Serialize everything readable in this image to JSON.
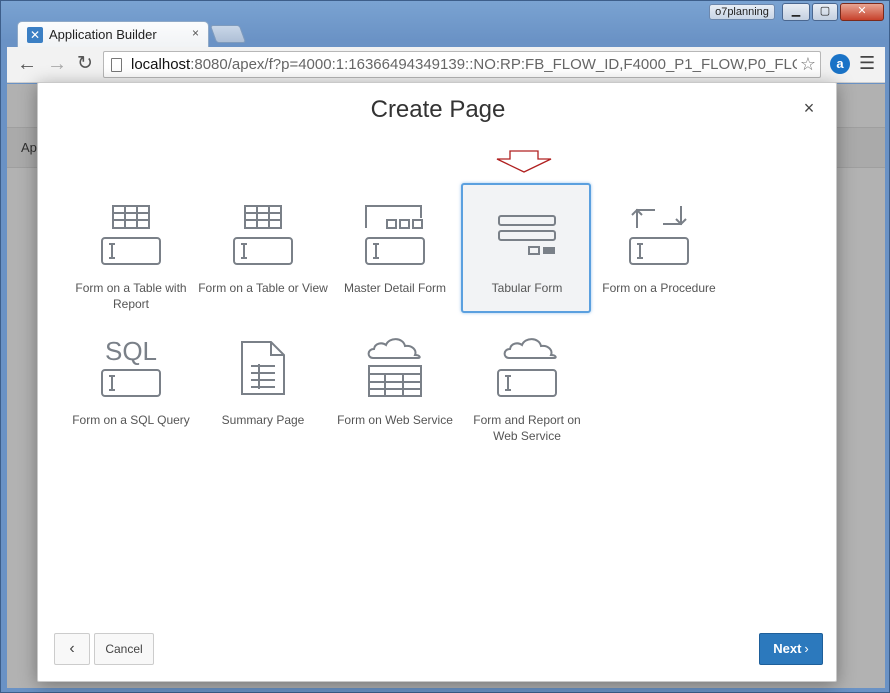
{
  "browser": {
    "tab_title": "Application Builder",
    "tab_close": "×",
    "user_badge": "o7planning",
    "window_controls": {
      "minimize": "▁",
      "maximize": "▢",
      "close": "✕"
    },
    "url_host": "localhost",
    "url_rest": ":8080/apex/f?p=4000:1:16366494349139::NO:RP:FB_FLOW_ID,F4000_P1_FLOW,P0_FLO",
    "icons": [
      "back-icon",
      "forward-icon",
      "reload-icon",
      "page-icon",
      "star-icon",
      "extension-icon",
      "menu-icon"
    ]
  },
  "background_page": {
    "crumb": "Ap"
  },
  "dialog": {
    "title": "Create Page",
    "close": "×",
    "tiles": [
      {
        "label": "Form on a Table with Report",
        "icon": "table-form-icon",
        "selected": false
      },
      {
        "label": "Form on a Table or View",
        "icon": "table-form-icon",
        "selected": false
      },
      {
        "label": "Master Detail Form",
        "icon": "master-detail-icon",
        "selected": false
      },
      {
        "label": "Tabular Form",
        "icon": "tabular-form-icon",
        "selected": true
      },
      {
        "label": "Form on a Procedure",
        "icon": "procedure-form-icon",
        "selected": false
      },
      {
        "label": "Form on a SQL Query",
        "icon": "sql-form-icon",
        "selected": false
      },
      {
        "label": "Summary Page",
        "icon": "document-icon",
        "selected": false
      },
      {
        "label": "Form on Web Service",
        "icon": "cloud-table-icon",
        "selected": false
      },
      {
        "label": "Form and Report on Web Service",
        "icon": "cloud-form-icon",
        "selected": false
      }
    ],
    "sql_text": "SQL",
    "buttons": {
      "previous": "‹",
      "cancel": "Cancel",
      "next": "Next",
      "next_chevron": "›"
    }
  },
  "colors": {
    "accent": "#2c79bd",
    "selected_border": "#5ba0df",
    "icon_stroke": "#7a8088",
    "annotation_arrow": "#b02020"
  }
}
